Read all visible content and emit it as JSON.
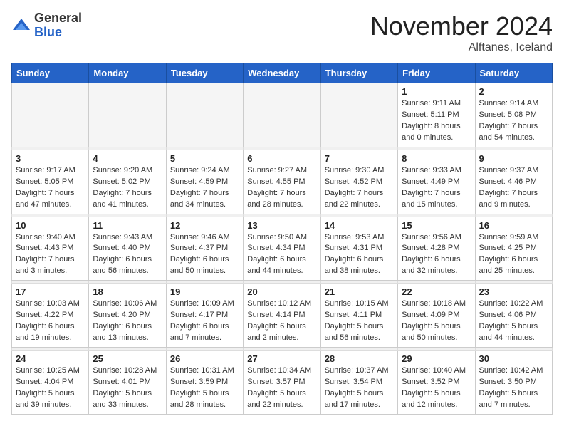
{
  "logo": {
    "general": "General",
    "blue": "Blue"
  },
  "header": {
    "month": "November 2024",
    "location": "Alftanes, Iceland"
  },
  "weekdays": [
    "Sunday",
    "Monday",
    "Tuesday",
    "Wednesday",
    "Thursday",
    "Friday",
    "Saturday"
  ],
  "weeks": [
    [
      {
        "day": "",
        "info": ""
      },
      {
        "day": "",
        "info": ""
      },
      {
        "day": "",
        "info": ""
      },
      {
        "day": "",
        "info": ""
      },
      {
        "day": "",
        "info": ""
      },
      {
        "day": "1",
        "info": "Sunrise: 9:11 AM\nSunset: 5:11 PM\nDaylight: 8 hours\nand 0 minutes."
      },
      {
        "day": "2",
        "info": "Sunrise: 9:14 AM\nSunset: 5:08 PM\nDaylight: 7 hours\nand 54 minutes."
      }
    ],
    [
      {
        "day": "3",
        "info": "Sunrise: 9:17 AM\nSunset: 5:05 PM\nDaylight: 7 hours\nand 47 minutes."
      },
      {
        "day": "4",
        "info": "Sunrise: 9:20 AM\nSunset: 5:02 PM\nDaylight: 7 hours\nand 41 minutes."
      },
      {
        "day": "5",
        "info": "Sunrise: 9:24 AM\nSunset: 4:59 PM\nDaylight: 7 hours\nand 34 minutes."
      },
      {
        "day": "6",
        "info": "Sunrise: 9:27 AM\nSunset: 4:55 PM\nDaylight: 7 hours\nand 28 minutes."
      },
      {
        "day": "7",
        "info": "Sunrise: 9:30 AM\nSunset: 4:52 PM\nDaylight: 7 hours\nand 22 minutes."
      },
      {
        "day": "8",
        "info": "Sunrise: 9:33 AM\nSunset: 4:49 PM\nDaylight: 7 hours\nand 15 minutes."
      },
      {
        "day": "9",
        "info": "Sunrise: 9:37 AM\nSunset: 4:46 PM\nDaylight: 7 hours\nand 9 minutes."
      }
    ],
    [
      {
        "day": "10",
        "info": "Sunrise: 9:40 AM\nSunset: 4:43 PM\nDaylight: 7 hours\nand 3 minutes."
      },
      {
        "day": "11",
        "info": "Sunrise: 9:43 AM\nSunset: 4:40 PM\nDaylight: 6 hours\nand 56 minutes."
      },
      {
        "day": "12",
        "info": "Sunrise: 9:46 AM\nSunset: 4:37 PM\nDaylight: 6 hours\nand 50 minutes."
      },
      {
        "day": "13",
        "info": "Sunrise: 9:50 AM\nSunset: 4:34 PM\nDaylight: 6 hours\nand 44 minutes."
      },
      {
        "day": "14",
        "info": "Sunrise: 9:53 AM\nSunset: 4:31 PM\nDaylight: 6 hours\nand 38 minutes."
      },
      {
        "day": "15",
        "info": "Sunrise: 9:56 AM\nSunset: 4:28 PM\nDaylight: 6 hours\nand 32 minutes."
      },
      {
        "day": "16",
        "info": "Sunrise: 9:59 AM\nSunset: 4:25 PM\nDaylight: 6 hours\nand 25 minutes."
      }
    ],
    [
      {
        "day": "17",
        "info": "Sunrise: 10:03 AM\nSunset: 4:22 PM\nDaylight: 6 hours\nand 19 minutes."
      },
      {
        "day": "18",
        "info": "Sunrise: 10:06 AM\nSunset: 4:20 PM\nDaylight: 6 hours\nand 13 minutes."
      },
      {
        "day": "19",
        "info": "Sunrise: 10:09 AM\nSunset: 4:17 PM\nDaylight: 6 hours\nand 7 minutes."
      },
      {
        "day": "20",
        "info": "Sunrise: 10:12 AM\nSunset: 4:14 PM\nDaylight: 6 hours\nand 2 minutes."
      },
      {
        "day": "21",
        "info": "Sunrise: 10:15 AM\nSunset: 4:11 PM\nDaylight: 5 hours\nand 56 minutes."
      },
      {
        "day": "22",
        "info": "Sunrise: 10:18 AM\nSunset: 4:09 PM\nDaylight: 5 hours\nand 50 minutes."
      },
      {
        "day": "23",
        "info": "Sunrise: 10:22 AM\nSunset: 4:06 PM\nDaylight: 5 hours\nand 44 minutes."
      }
    ],
    [
      {
        "day": "24",
        "info": "Sunrise: 10:25 AM\nSunset: 4:04 PM\nDaylight: 5 hours\nand 39 minutes."
      },
      {
        "day": "25",
        "info": "Sunrise: 10:28 AM\nSunset: 4:01 PM\nDaylight: 5 hours\nand 33 minutes."
      },
      {
        "day": "26",
        "info": "Sunrise: 10:31 AM\nSunset: 3:59 PM\nDaylight: 5 hours\nand 28 minutes."
      },
      {
        "day": "27",
        "info": "Sunrise: 10:34 AM\nSunset: 3:57 PM\nDaylight: 5 hours\nand 22 minutes."
      },
      {
        "day": "28",
        "info": "Sunrise: 10:37 AM\nSunset: 3:54 PM\nDaylight: 5 hours\nand 17 minutes."
      },
      {
        "day": "29",
        "info": "Sunrise: 10:40 AM\nSunset: 3:52 PM\nDaylight: 5 hours\nand 12 minutes."
      },
      {
        "day": "30",
        "info": "Sunrise: 10:42 AM\nSunset: 3:50 PM\nDaylight: 5 hours\nand 7 minutes."
      }
    ]
  ]
}
